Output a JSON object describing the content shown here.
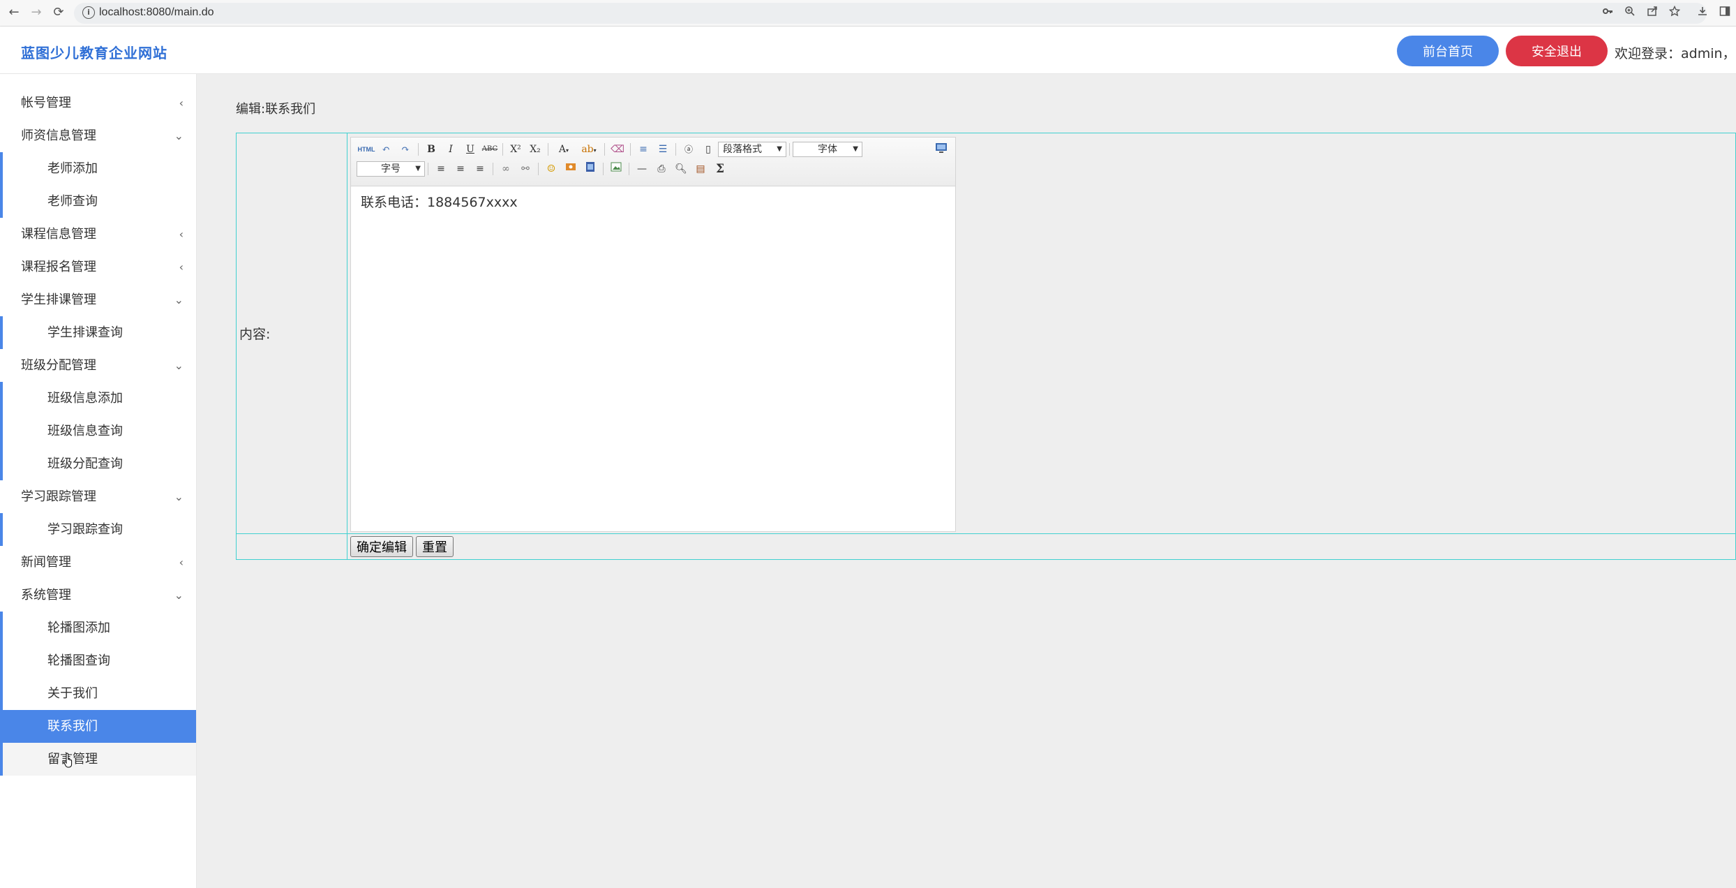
{
  "browser": {
    "url": "localhost:8080/main.do",
    "back_icon": "←",
    "forward_icon": "→",
    "reload_icon": "⟳"
  },
  "header": {
    "brand": "蓝图少儿教育企业网站",
    "front_button": "前台首页",
    "logout_button": "安全退出",
    "welcome": "欢迎登录：admin，管",
    "accent_color": "#4a86e8",
    "danger_color": "#dc3545"
  },
  "sidebar": {
    "items": [
      {
        "label": "帐号管理",
        "expanded": false
      },
      {
        "label": "师资信息管理",
        "expanded": true,
        "children": [
          "老师添加",
          "老师查询"
        ]
      },
      {
        "label": "课程信息管理",
        "expanded": false
      },
      {
        "label": "课程报名管理",
        "expanded": false
      },
      {
        "label": "学生排课管理",
        "expanded": true,
        "children": [
          "学生排课查询"
        ]
      },
      {
        "label": "班级分配管理",
        "expanded": true,
        "children": [
          "班级信息添加",
          "班级信息查询",
          "班级分配查询"
        ]
      },
      {
        "label": "学习跟踪管理",
        "expanded": true,
        "children": [
          "学习跟踪查询"
        ]
      },
      {
        "label": "新闻管理",
        "expanded": false
      },
      {
        "label": "系统管理",
        "expanded": true,
        "children": [
          "轮播图添加",
          "轮播图查询",
          "关于我们",
          "联系我们",
          "留言管理"
        ]
      }
    ],
    "active_item": "联系我们"
  },
  "main": {
    "breadcrumb": "编辑:联系我们",
    "content_label": "内容:",
    "editor": {
      "paragraph_select": "段落格式",
      "font_select": "字体",
      "size_select": "字号",
      "content": "联系电话：1884567xxxx"
    },
    "submit_button": "确定编辑",
    "reset_button": "重置"
  }
}
